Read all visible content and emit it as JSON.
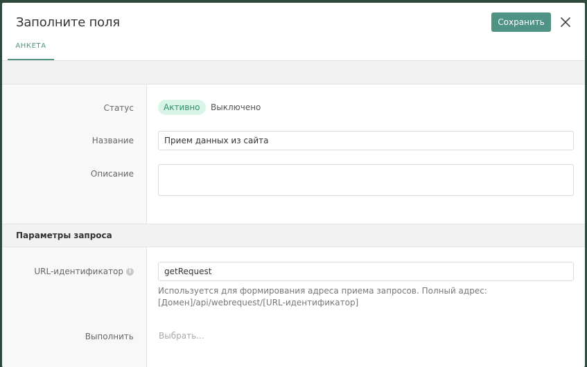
{
  "modal": {
    "title": "Заполните поля",
    "save_label": "Сохранить",
    "tabs": [
      {
        "label": "АНКЕТА",
        "active": true
      }
    ]
  },
  "form": {
    "status": {
      "label": "Статус",
      "options": [
        "Активно",
        "Выключено"
      ],
      "selected": "Активно"
    },
    "name": {
      "label": "Название",
      "value": "Прием данных из сайта"
    },
    "description": {
      "label": "Описание",
      "value": ""
    }
  },
  "request_params": {
    "section_title": "Параметры запроса",
    "url_id": {
      "label": "URL-идентификатор",
      "value": "getRequest",
      "hint_line1": "Используется для формирования адреса приема запросов. Полный адрес:",
      "hint_line2": "[Домен]/api/webrequest/[URL-идентификатор]"
    },
    "execute": {
      "label": "Выполнить",
      "placeholder": "Выбрать..."
    }
  },
  "colors": {
    "accent": "#4f9384",
    "active_pill_bg": "#d8f5e8",
    "active_pill_text": "#2f8f66"
  },
  "icons": {
    "close": "close-icon",
    "info": "info-icon"
  }
}
